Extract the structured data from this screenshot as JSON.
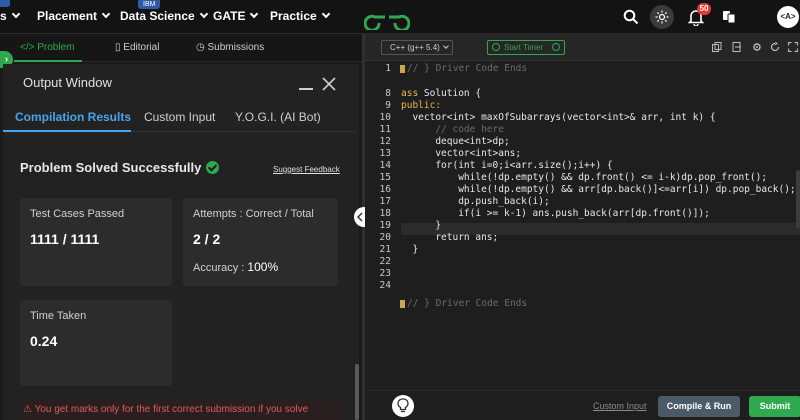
{
  "nav": {
    "items": [
      "s",
      "Placement",
      "Data Science",
      "GATE",
      "Practice"
    ],
    "ibm_tag": "IBM",
    "notifications": "50",
    "avatar": "<A>"
  },
  "problem_tabs": [
    "Problem",
    "Editorial",
    "Submissions"
  ],
  "output_window": {
    "title": "Output Window",
    "tabs": [
      "Compilation Results",
      "Custom Input",
      "Y.O.G.I. (AI Bot)"
    ],
    "status": "Problem Solved Successfully",
    "feedback_link": "Suggest Feedback",
    "cards": {
      "tests_label": "Test Cases Passed",
      "tests_value": "1111 / 1111",
      "attempts_label": "Attempts : Correct / Total",
      "attempts_value": "2 / 2",
      "accuracy_label": "Accuracy :",
      "accuracy_value": "100%",
      "time_label": "Time Taken",
      "time_value": "0.24"
    },
    "warning": "You get marks only for the first correct submission if you solve"
  },
  "editor": {
    "language": "C++ (g++ 5.4)",
    "timer_label": "Start Timer",
    "line_numbers": [
      "1",
      "8",
      "9",
      "10",
      "11",
      "12",
      "13",
      "14",
      "15",
      "16",
      "17",
      "18",
      "19",
      "20",
      "21",
      "22",
      "23",
      "24"
    ],
    "code_lines": [
      "// } Driver Code Ends",
      "",
      "ass Solution {",
      "public:",
      "  vector<int> maxOfSubarrays(vector<int>& arr, int k) {",
      "      // code here",
      "      deque<int>dp;",
      "      vector<int>ans;",
      "      for(int i=0;i<arr.size();i++) {",
      "          while(!dp.empty() && dp.front() <= i-k)dp.pop_front();",
      "          while(!dp.empty() && arr[dp.back()]<=arr[i]) dp.pop_back();",
      "          dp.push_back(i);",
      "          if(i >= k-1) ans.push_back(arr[dp.front()]);",
      "      }",
      "      return ans;",
      "  }",
      "",
      "",
      "// } Driver Code Ends"
    ],
    "custom_input": "Custom Input",
    "compile_run": "Compile & Run",
    "submit": "Submit"
  }
}
